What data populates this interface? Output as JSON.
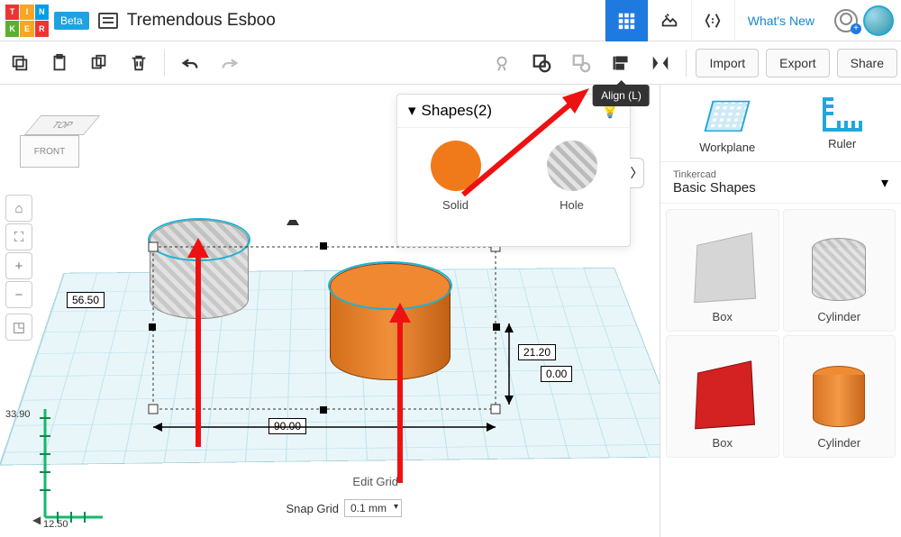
{
  "topbar": {
    "logo_letters": [
      "T",
      "I",
      "N",
      "K",
      "E",
      "R"
    ],
    "logo_colors": [
      "#e33",
      "#f5a623",
      "#009fe3",
      "#5ab031",
      "#f5a623",
      "#e33"
    ],
    "beta": "Beta",
    "project_title": "Tremendous Esboo",
    "whats_new": "What's New"
  },
  "toolbar": {
    "import": "Import",
    "export": "Export",
    "share": "Share",
    "align_tooltip": "Align (L)"
  },
  "shapes_panel": {
    "title": "Shapes(2)",
    "solid": "Solid",
    "hole": "Hole"
  },
  "sidebar": {
    "workplane": "Workplane",
    "ruler": "Ruler",
    "lib_group": "Tinkercad",
    "lib_name": "Basic Shapes",
    "shapes": {
      "box": "Box",
      "cylinder": "Cylinder",
      "box2": "Box",
      "cylinder2": "Cylinder"
    }
  },
  "canvas": {
    "viewcube_top": "TOP",
    "viewcube_front": "FRONT",
    "edit_grid": "Edit Grid",
    "snap_label": "Snap Grid",
    "snap_value": "0.1 mm",
    "dim_left": "56.50",
    "dim_bottom": "90.00",
    "dim_right_h": "21.20",
    "dim_right_z": "0.00",
    "ruler_y": "33.90",
    "ruler_x": "12.50"
  }
}
